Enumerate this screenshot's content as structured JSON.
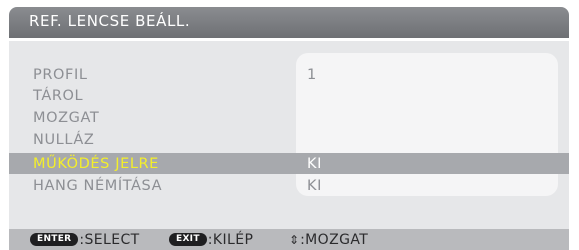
{
  "title": "REF. LENCSE BEÁLL.",
  "menu": {
    "items": [
      {
        "label": "PROFIL",
        "value": "1"
      },
      {
        "label": "TÁROL",
        "value": ""
      },
      {
        "label": "MOZGAT",
        "value": ""
      },
      {
        "label": "NULLÁZ",
        "value": ""
      },
      {
        "label": "MŰKÖDÉS JELRE",
        "value": "KI"
      },
      {
        "label": "HANG NÉMÍTÁSA",
        "value": "KI"
      }
    ],
    "selected_index": 4
  },
  "footer": {
    "enter_key": "ENTER",
    "enter_text": ":SELECT",
    "exit_key": "EXIT",
    "exit_text": ":KILÉP",
    "move_icon": "up-down-arrow-icon",
    "move_text": ":MOZGAT"
  },
  "colors": {
    "title_bar": "#7b7d81",
    "panel": "#e6e7e9",
    "value_box": "#f5f5f6",
    "selection_bar": "#a7a9ad",
    "selected_label": "#f4ef2a",
    "text": "#8d8f94",
    "footer": "#b9babd"
  }
}
